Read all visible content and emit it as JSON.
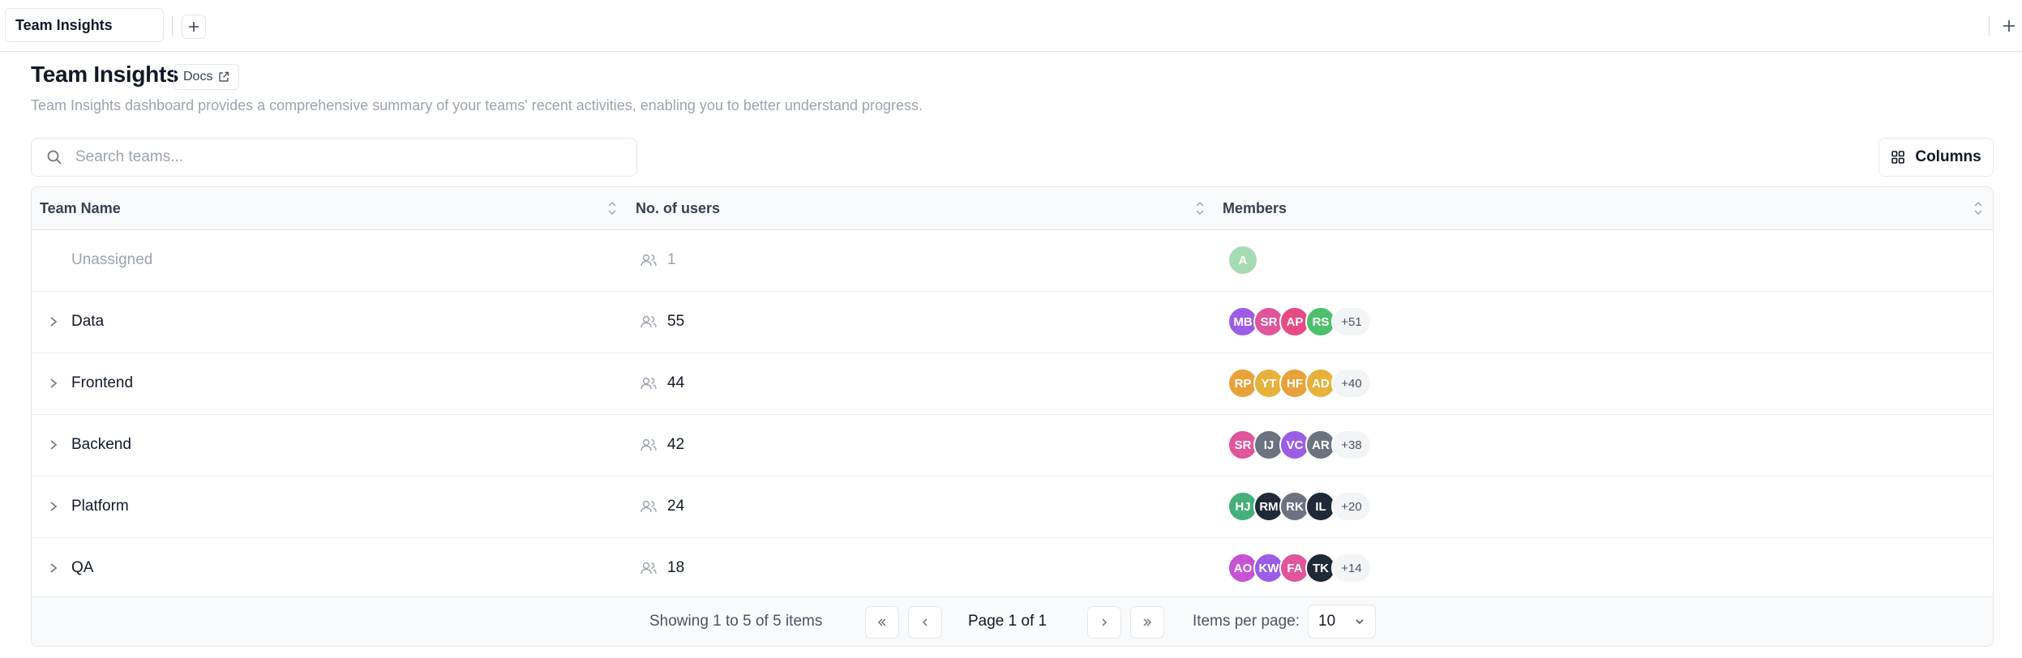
{
  "tabs": {
    "active_label": "Team Insights",
    "add_symbol": "+",
    "right_add_symbol": "+"
  },
  "header": {
    "title": "Team Insights",
    "docs_label": "Docs",
    "description": "Team Insights dashboard provides a comprehensive summary of your teams' recent activities, enabling you to better understand progress."
  },
  "search": {
    "placeholder": "Search teams...",
    "value": ""
  },
  "columns_button": {
    "label": "Columns"
  },
  "table": {
    "headers": [
      "Team Name",
      "No. of users",
      "Members"
    ],
    "rows": [
      {
        "name": "Unassigned",
        "users": "1",
        "members": [
          {
            "initials": "A",
            "color": "#a7dbb3"
          }
        ],
        "more": ""
      },
      {
        "name": "Data",
        "users": "55",
        "members": [
          {
            "initials": "MB",
            "color": "#9b5de5"
          },
          {
            "initials": "SR",
            "color": "#e0559b"
          },
          {
            "initials": "AP",
            "color": "#e84a84"
          },
          {
            "initials": "RS",
            "color": "#4cc06a"
          }
        ],
        "more": "+51"
      },
      {
        "name": "Frontend",
        "users": "44",
        "members": [
          {
            "initials": "RP",
            "color": "#e9a23b"
          },
          {
            "initials": "YT",
            "color": "#e6b23c"
          },
          {
            "initials": "HF",
            "color": "#e9a23b"
          },
          {
            "initials": "AD",
            "color": "#e6b23c"
          }
        ],
        "more": "+40"
      },
      {
        "name": "Backend",
        "users": "42",
        "members": [
          {
            "initials": "SR",
            "color": "#e0559b"
          },
          {
            "initials": "IJ",
            "color": "#6b7280"
          },
          {
            "initials": "VC",
            "color": "#9b5de5"
          },
          {
            "initials": "AR",
            "color": "#6b7280"
          }
        ],
        "more": "+38"
      },
      {
        "name": "Platform",
        "users": "24",
        "members": [
          {
            "initials": "HJ",
            "color": "#45b07c"
          },
          {
            "initials": "RM",
            "color": "#1f2937"
          },
          {
            "initials": "RK",
            "color": "#6b7280"
          },
          {
            "initials": "IL",
            "color": "#1f2937"
          }
        ],
        "more": "+20"
      },
      {
        "name": "QA",
        "users": "18",
        "members": [
          {
            "initials": "AO",
            "color": "#c653d6"
          },
          {
            "initials": "KW",
            "color": "#9b5de5"
          },
          {
            "initials": "FA",
            "color": "#e0559b"
          },
          {
            "initials": "TK",
            "color": "#1f2937"
          }
        ],
        "more": "+14"
      }
    ]
  },
  "pagination": {
    "showing_text": "Showing 1 to 5 of 5 items",
    "page_text": "Page 1 of 1",
    "items_per_page_label": "Items per page:",
    "items_per_page_value": "10"
  }
}
